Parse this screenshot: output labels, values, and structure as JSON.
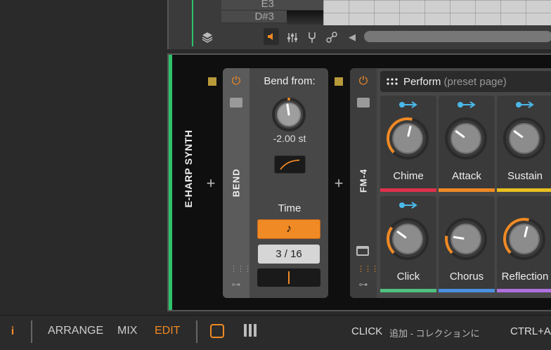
{
  "arranger": {
    "keys": [
      "E3",
      "D#3"
    ]
  },
  "track": {
    "name": "E-HARP SYNTH"
  },
  "bend_device": {
    "name": "BEND",
    "bend_from_label": "Bend from:",
    "bend_value": "-2.00 st",
    "bend_knob_fraction": 0.45,
    "time_label": "Time",
    "note_icon": "♪",
    "time_ratio": "3 / 16"
  },
  "fm4_device": {
    "name": "FM-4",
    "preset_title": "Perform",
    "preset_subtitle": "(preset page)",
    "params": [
      {
        "label": "Chime",
        "stripe": "#e0304a",
        "mod": true,
        "value": 0.55,
        "arc": true
      },
      {
        "label": "Attack",
        "stripe": "#f08a24",
        "mod": true,
        "value": 0.3,
        "arc": false
      },
      {
        "label": "Sustain",
        "stripe": "#e8c020",
        "mod": true,
        "value": 0.3,
        "arc": false
      },
      {
        "label": "Click",
        "stripe": "#50c080",
        "mod": true,
        "value": 0.3,
        "arc": true
      },
      {
        "label": "Chorus",
        "stripe": "#4a90e0",
        "mod": false,
        "value": 0.2,
        "arc": true
      },
      {
        "label": "Reflection",
        "stripe": "#b070e0",
        "mod": false,
        "value": 0.55,
        "arc": true
      }
    ]
  },
  "bottom_bar": {
    "info_icon": "i",
    "arrange": "ARRANGE",
    "mix": "MIX",
    "edit": "EDIT",
    "status_action": "CLICK",
    "status_description": "追加 - コレクションに",
    "status_shortcut": "CTRL+AL"
  },
  "colors": {
    "accent": "#f08a24",
    "track": "#2ec26a",
    "mod": "#4ab8e8"
  }
}
